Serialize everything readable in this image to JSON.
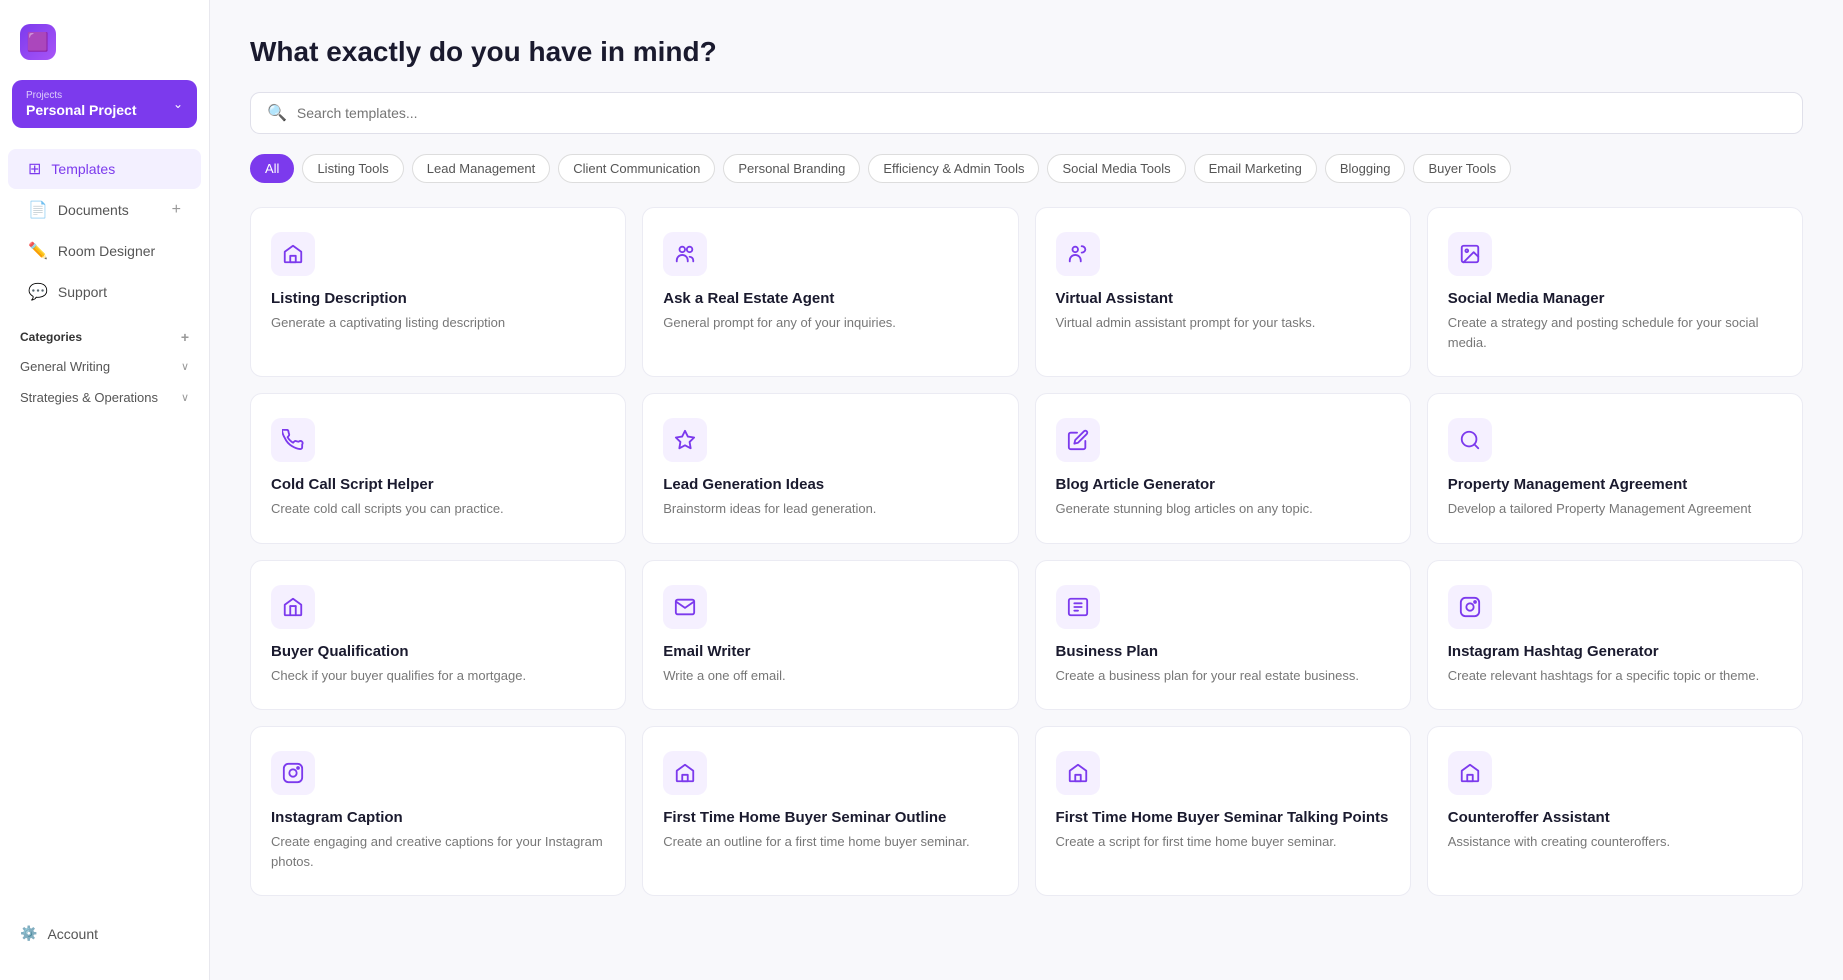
{
  "sidebar": {
    "logo_icon": "🟪",
    "project": {
      "label": "Projects",
      "name": "Personal Project",
      "chevron": "❯"
    },
    "nav_items": [
      {
        "id": "templates",
        "label": "Templates",
        "icon": "⊞",
        "active": true
      },
      {
        "id": "documents",
        "label": "Documents",
        "icon": "📄",
        "active": false
      },
      {
        "id": "room-designer",
        "label": "Room Designer",
        "icon": "🖋",
        "active": false
      },
      {
        "id": "support",
        "label": "Support",
        "icon": "💬",
        "active": false
      }
    ],
    "categories_title": "Categories",
    "categories": [
      {
        "id": "general-writing",
        "label": "General Writing"
      },
      {
        "id": "strategies-operations",
        "label": "Strategies & Operations"
      }
    ],
    "account_label": "Account"
  },
  "main": {
    "title": "What exactly do you have in mind?",
    "search_placeholder": "Search templates...",
    "filters": [
      {
        "id": "all",
        "label": "All",
        "active": true
      },
      {
        "id": "listing-tools",
        "label": "Listing Tools",
        "active": false
      },
      {
        "id": "lead-management",
        "label": "Lead Management",
        "active": false
      },
      {
        "id": "client-communication",
        "label": "Client Communication",
        "active": false
      },
      {
        "id": "personal-branding",
        "label": "Personal Branding",
        "active": false
      },
      {
        "id": "efficiency-admin",
        "label": "Efficiency & Admin Tools",
        "active": false
      },
      {
        "id": "social-media",
        "label": "Social Media Tools",
        "active": false
      },
      {
        "id": "email-marketing",
        "label": "Email Marketing",
        "active": false
      },
      {
        "id": "blogging",
        "label": "Blogging",
        "active": false
      },
      {
        "id": "buyer-tools",
        "label": "Buyer Tools",
        "active": false
      }
    ],
    "cards": [
      {
        "id": "listing-description",
        "icon": "🏠",
        "title": "Listing Description",
        "desc": "Generate a captivating listing description"
      },
      {
        "id": "ask-real-estate-agent",
        "icon": "👥",
        "title": "Ask a Real Estate Agent",
        "desc": "General prompt for any of your inquiries."
      },
      {
        "id": "virtual-assistant",
        "icon": "🤝",
        "title": "Virtual Assistant",
        "desc": "Virtual admin assistant prompt for your tasks."
      },
      {
        "id": "social-media-manager",
        "icon": "📊",
        "title": "Social Media Manager",
        "desc": "Create a strategy and posting schedule for your social media."
      },
      {
        "id": "cold-call-script",
        "icon": "📞",
        "title": "Cold Call Script Helper",
        "desc": "Create cold call scripts you can practice."
      },
      {
        "id": "lead-generation-ideas",
        "icon": "📈",
        "title": "Lead Generation Ideas",
        "desc": "Brainstorm ideas for lead generation."
      },
      {
        "id": "blog-article-generator",
        "icon": "✏️",
        "title": "Blog Article Generator",
        "desc": "Generate stunning blog articles on any topic."
      },
      {
        "id": "property-management-agreement",
        "icon": "🔍",
        "title": "Property Management Agreement",
        "desc": "Develop a tailored Property Management Agreement"
      },
      {
        "id": "buyer-qualification",
        "icon": "🏘",
        "title": "Buyer Qualification",
        "desc": "Check if your buyer qualifies for a mortgage."
      },
      {
        "id": "email-writer",
        "icon": "✉️",
        "title": "Email Writer",
        "desc": "Write a one off email."
      },
      {
        "id": "business-plan",
        "icon": "📋",
        "title": "Business Plan",
        "desc": "Create a business plan for your real estate business."
      },
      {
        "id": "instagram-hashtag-generator",
        "icon": "📷",
        "title": "Instagram Hashtag Generator",
        "desc": "Create relevant hashtags for a specific topic or theme."
      },
      {
        "id": "instagram-caption",
        "icon": "📷",
        "title": "Instagram Caption",
        "desc": "Create engaging and creative captions for your Instagram photos."
      },
      {
        "id": "first-time-home-buyer-outline",
        "icon": "🏠",
        "title": "First Time Home Buyer Seminar Outline",
        "desc": "Create an outline for a first time home buyer seminar."
      },
      {
        "id": "first-time-home-buyer-talking-points",
        "icon": "🏠",
        "title": "First Time Home Buyer Seminar Talking Points",
        "desc": "Create a script for first time home buyer seminar."
      },
      {
        "id": "counteroffer-assistant",
        "icon": "🏠",
        "title": "Counteroffer Assistant",
        "desc": "Assistance with creating counteroffers."
      }
    ]
  }
}
